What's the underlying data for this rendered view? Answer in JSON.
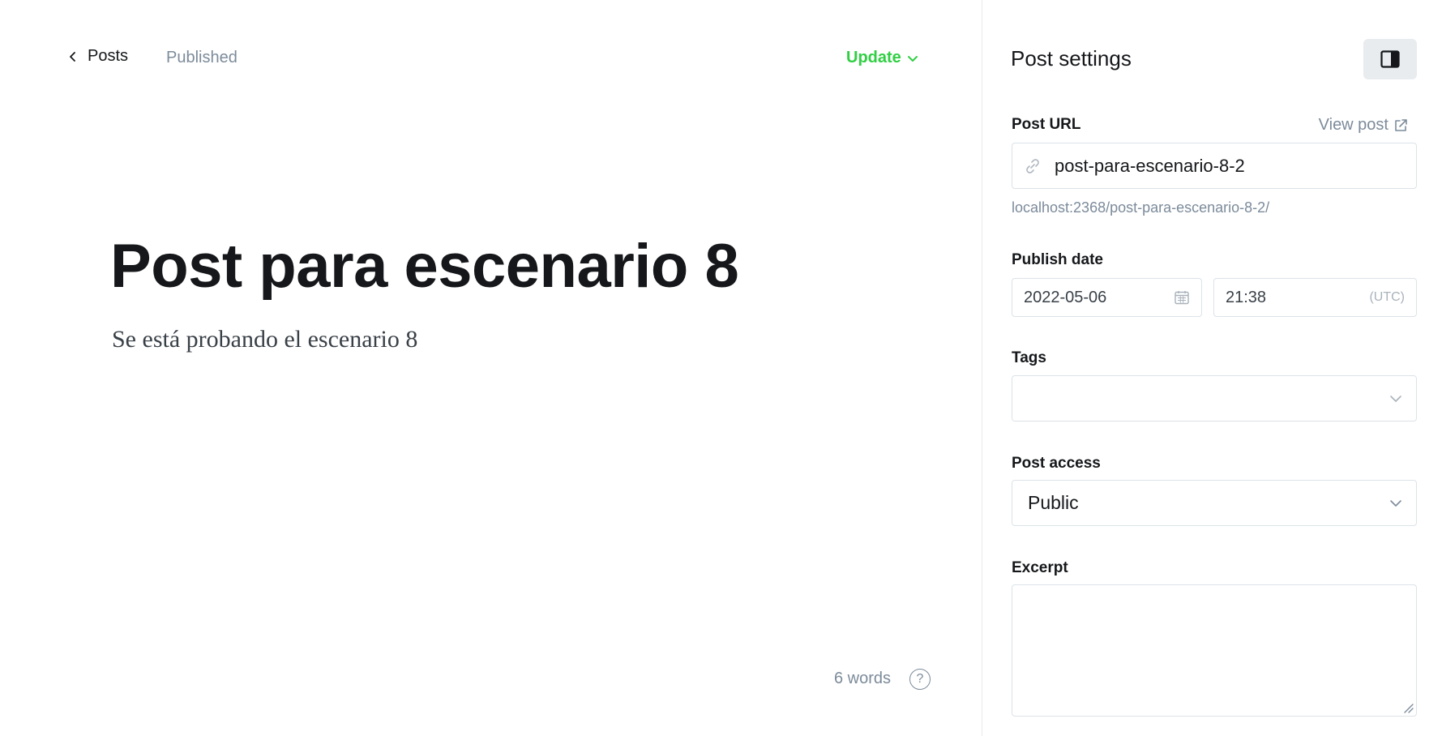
{
  "topbar": {
    "back_label": "Posts",
    "status": "Published",
    "update_label": "Update"
  },
  "post": {
    "title": "Post para escenario 8",
    "body": "Se está probando el escenario 8",
    "word_count": "6 words",
    "help_glyph": "?"
  },
  "settings": {
    "title": "Post settings",
    "url": {
      "label": "Post URL",
      "view_post_label": "View post",
      "value": "post-para-escenario-8-2",
      "hint": "localhost:2368/post-para-escenario-8-2/"
    },
    "publish_date": {
      "label": "Publish date",
      "date": "2022-05-06",
      "time": "21:38",
      "timezone": "(UTC)"
    },
    "tags": {
      "label": "Tags",
      "value": ""
    },
    "access": {
      "label": "Post access",
      "value": "Public"
    },
    "excerpt": {
      "label": "Excerpt",
      "value": ""
    }
  },
  "icons": {
    "back": "chevron-left-icon",
    "update_dropdown": "chevron-down-icon",
    "panel_toggle": "sidebar-panel-icon",
    "external_link": "external-link-icon",
    "link": "link-icon",
    "calendar": "calendar-icon",
    "select_arrow": "chevron-down-icon",
    "help": "question-circle-icon"
  },
  "colors": {
    "accent_green": "#30cf43",
    "muted_text": "#7c8b9a",
    "border": "#dce3e9",
    "toggle_bg": "#e8ecef"
  }
}
